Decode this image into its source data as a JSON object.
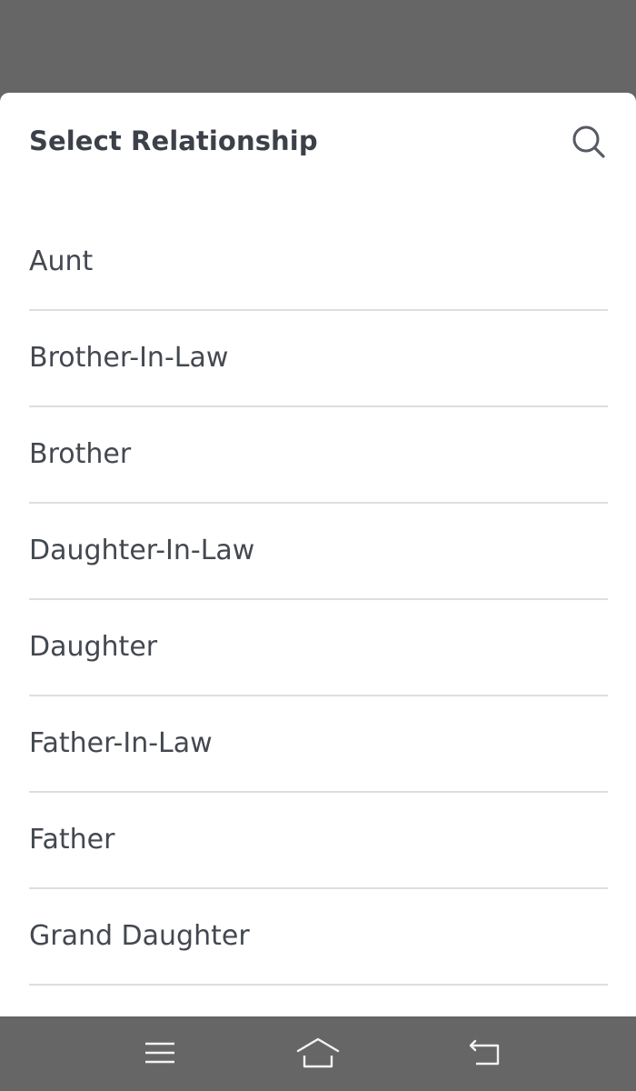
{
  "sheet": {
    "title": "Select Relationship",
    "search_icon": "search-icon",
    "items": [
      {
        "label": "Aunt"
      },
      {
        "label": "Brother-In-Law"
      },
      {
        "label": "Brother"
      },
      {
        "label": "Daughter-In-Law"
      },
      {
        "label": "Daughter"
      },
      {
        "label": "Father-In-Law"
      },
      {
        "label": "Father"
      },
      {
        "label": "Grand Daughter"
      }
    ]
  },
  "nav_bar": {
    "menu_icon": "menu-icon",
    "home_icon": "home-icon",
    "back_icon": "back-icon"
  },
  "colors": {
    "overlay": "#666666",
    "sheet_background": "#ffffff",
    "title_text": "#3c4048",
    "item_text": "#444850",
    "divider": "#dedede",
    "icon": "#555a63",
    "nav_icon": "#f2f2f2"
  }
}
